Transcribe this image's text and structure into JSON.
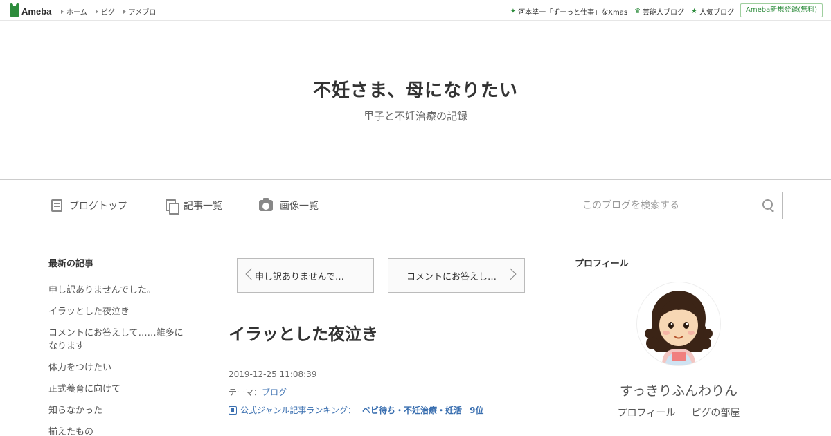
{
  "topbar": {
    "logo_text": "Ameba",
    "nav": [
      "ホーム",
      "ピグ",
      "アメブロ"
    ],
    "right_links": [
      {
        "label": "河本準一「ずーっと仕事」なXmas",
        "icon": "sparkle-icon"
      },
      {
        "label": "芸能人ブログ",
        "icon": "crown-icon"
      },
      {
        "label": "人気ブログ",
        "icon": "star-icon"
      }
    ],
    "signup_label": "Ameba新規登録(無料)"
  },
  "header": {
    "title": "不妊さま、母になりたい",
    "subtitle": "里子と不妊治療の記録"
  },
  "navbar": {
    "items": [
      "ブログトップ",
      "記事一覧",
      "画像一覧"
    ],
    "search_placeholder": "このブログを検索する"
  },
  "sidebar": {
    "title": "最新の記事",
    "items": [
      "申し訳ありませんでした。",
      "イラッとした夜泣き",
      "コメントにお答えして……雑多になります",
      "体力をつけたい",
      "正式養育に向けて",
      "知らなかった",
      "揃えたもの"
    ]
  },
  "main": {
    "prev_label": "申し訳ありませんで…",
    "next_label": "コメントにお答えし…",
    "entry_title": "イラッとした夜泣き",
    "date": "2019-12-25 11:08:39",
    "theme_prefix": "テーマ：",
    "theme": "ブログ",
    "ranking_label": "公式ジャンル記事ランキング：",
    "ranking_genre": "ベビ待ち・不妊治療・妊活",
    "ranking_position": "9位"
  },
  "profile": {
    "title": "プロフィール",
    "name": "すっきりふんわりん",
    "links": [
      "プロフィール",
      "ピグの部屋"
    ]
  },
  "colors": {
    "brand_green": "#2d8c3c",
    "link_blue": "#3a6fb0"
  }
}
